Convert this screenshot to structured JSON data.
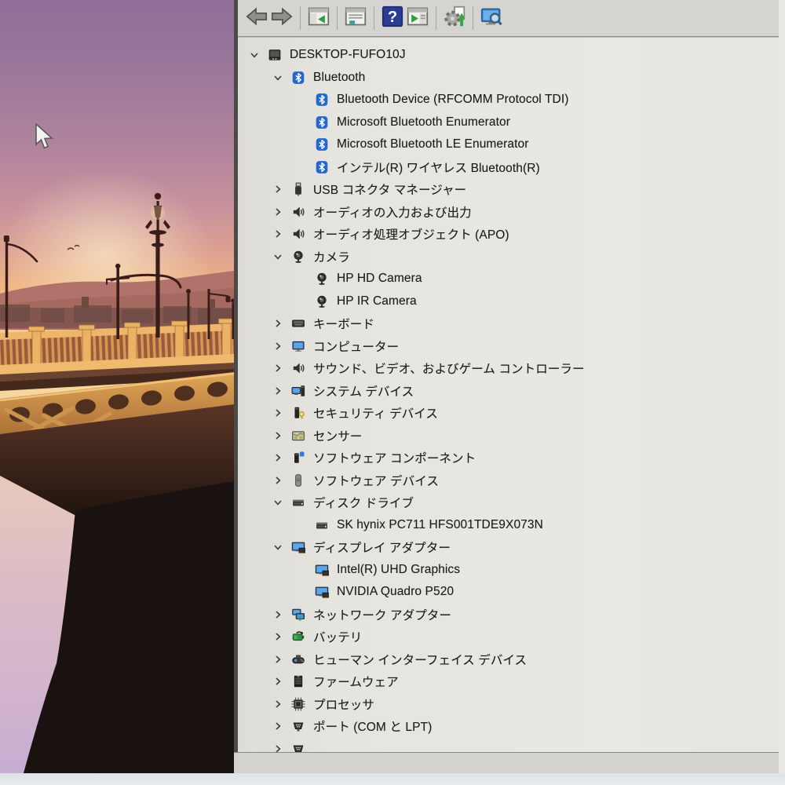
{
  "window": {
    "app": "device-manager",
    "toolbar": {
      "items": [
        {
          "name": "back-button",
          "icon": "back-arrow-icon"
        },
        {
          "name": "forward-button",
          "icon": "forward-arrow-icon"
        },
        {
          "name": "separator"
        },
        {
          "name": "console-tree-toggle-button",
          "icon": "console-tree-icon"
        },
        {
          "name": "separator"
        },
        {
          "name": "properties-button",
          "icon": "properties-icon"
        },
        {
          "name": "separator"
        },
        {
          "name": "help-button",
          "icon": "help-icon"
        },
        {
          "name": "action-pane-toggle-button",
          "icon": "action-pane-icon"
        },
        {
          "name": "separator"
        },
        {
          "name": "scan-hardware-changes-button",
          "icon": "scan-hardware-icon"
        },
        {
          "name": "separator"
        },
        {
          "name": "search-computer-button",
          "icon": "search-computer-icon"
        }
      ]
    },
    "tree": {
      "items": [
        {
          "id": "computer-root",
          "label": "DESKTOP-FUFO10J",
          "level": 0,
          "state": "expanded",
          "icon": "computer"
        },
        {
          "id": "category-bluetooth",
          "label": "Bluetooth",
          "level": 1,
          "state": "expanded",
          "icon": "bluetooth"
        },
        {
          "id": "device-bluetooth-rfcomm",
          "label": "Bluetooth Device (RFCOMM Protocol TDI)",
          "level": 2,
          "state": "leaf",
          "icon": "bluetooth"
        },
        {
          "id": "device-ms-bt-enumerator",
          "label": "Microsoft Bluetooth Enumerator",
          "level": 2,
          "state": "leaf",
          "icon": "bluetooth"
        },
        {
          "id": "device-ms-bt-le-enumerator",
          "label": "Microsoft Bluetooth LE Enumerator",
          "level": 2,
          "state": "leaf",
          "icon": "bluetooth"
        },
        {
          "id": "device-intel-wireless-bt",
          "label": "インテル(R) ワイヤレス Bluetooth(R)",
          "level": 2,
          "state": "leaf",
          "icon": "bluetooth"
        },
        {
          "id": "category-usb-connector",
          "label": "USB コネクタ マネージャー",
          "level": 1,
          "state": "collapsed",
          "icon": "usb"
        },
        {
          "id": "category-audio-io",
          "label": "オーディオの入力および出力",
          "level": 1,
          "state": "collapsed",
          "icon": "audio"
        },
        {
          "id": "category-audio-apo",
          "label": "オーディオ処理オブジェクト (APO)",
          "level": 1,
          "state": "collapsed",
          "icon": "audio"
        },
        {
          "id": "category-camera",
          "label": "カメラ",
          "level": 1,
          "state": "expanded",
          "icon": "camera"
        },
        {
          "id": "device-hp-hd-camera",
          "label": "HP HD Camera",
          "level": 2,
          "state": "leaf",
          "icon": "camera"
        },
        {
          "id": "device-hp-ir-camera",
          "label": "HP IR Camera",
          "level": 2,
          "state": "leaf",
          "icon": "camera"
        },
        {
          "id": "category-keyboard",
          "label": "キーボード",
          "level": 1,
          "state": "collapsed",
          "icon": "keyboard"
        },
        {
          "id": "category-computer",
          "label": "コンピューター",
          "level": 1,
          "state": "collapsed",
          "icon": "computerblue"
        },
        {
          "id": "category-sound-video-game",
          "label": "サウンド、ビデオ、およびゲーム コントローラー",
          "level": 1,
          "state": "collapsed",
          "icon": "audio"
        },
        {
          "id": "category-system-devices",
          "label": "システム デバイス",
          "level": 1,
          "state": "collapsed",
          "icon": "system"
        },
        {
          "id": "category-security-devices",
          "label": "セキュリティ デバイス",
          "level": 1,
          "state": "collapsed",
          "icon": "security"
        },
        {
          "id": "category-sensors",
          "label": "センサー",
          "level": 1,
          "state": "collapsed",
          "icon": "sensor"
        },
        {
          "id": "category-sw-components",
          "label": "ソフトウェア コンポーネント",
          "level": 1,
          "state": "collapsed",
          "icon": "swcomponent"
        },
        {
          "id": "category-sw-devices",
          "label": "ソフトウェア デバイス",
          "level": 1,
          "state": "collapsed",
          "icon": "swdevice"
        },
        {
          "id": "category-disk-drives",
          "label": "ディスク ドライブ",
          "level": 1,
          "state": "expanded",
          "icon": "disk"
        },
        {
          "id": "device-sk-hynix",
          "label": "SK hynix PC711 HFS001TDE9X073N",
          "level": 2,
          "state": "leaf",
          "icon": "disk"
        },
        {
          "id": "category-display-adapters",
          "label": "ディスプレイ アダプター",
          "level": 1,
          "state": "expanded",
          "icon": "display"
        },
        {
          "id": "device-intel-uhd",
          "label": "Intel(R) UHD Graphics",
          "level": 2,
          "state": "leaf",
          "icon": "display"
        },
        {
          "id": "device-nvidia-quadro",
          "label": "NVIDIA Quadro P520",
          "level": 2,
          "state": "leaf",
          "icon": "display"
        },
        {
          "id": "category-network-adapters",
          "label": "ネットワーク アダプター",
          "level": 1,
          "state": "collapsed",
          "icon": "network"
        },
        {
          "id": "category-battery",
          "label": "バッテリ",
          "level": 1,
          "state": "collapsed",
          "icon": "battery"
        },
        {
          "id": "category-hid",
          "label": "ヒューマン インターフェイス デバイス",
          "level": 1,
          "state": "collapsed",
          "icon": "hid"
        },
        {
          "id": "category-firmware",
          "label": "ファームウェア",
          "level": 1,
          "state": "collapsed",
          "icon": "firmware"
        },
        {
          "id": "category-processors",
          "label": "プロセッサ",
          "level": 1,
          "state": "collapsed",
          "icon": "processor"
        },
        {
          "id": "category-ports",
          "label": "ポート (COM と LPT)",
          "level": 1,
          "state": "collapsed",
          "icon": "port"
        },
        {
          "id": "category-next-partial",
          "label": "",
          "level": 1,
          "state": "collapsed",
          "icon": "port"
        }
      ]
    }
  },
  "colors": {
    "bluetooth_blue": "#2468cf",
    "monitor_blue": "#3f8fd8",
    "help_navy": "#2b3c95",
    "action_green": "#2e9e43",
    "toolbar_bg": "#d5d4d0",
    "tree_bg": "#e6e5e0",
    "text": "#1c1c1c",
    "bridge_gold": "#d89a52",
    "sky_purple": "#8e6f98",
    "sky_orange": "#f4c88e"
  }
}
